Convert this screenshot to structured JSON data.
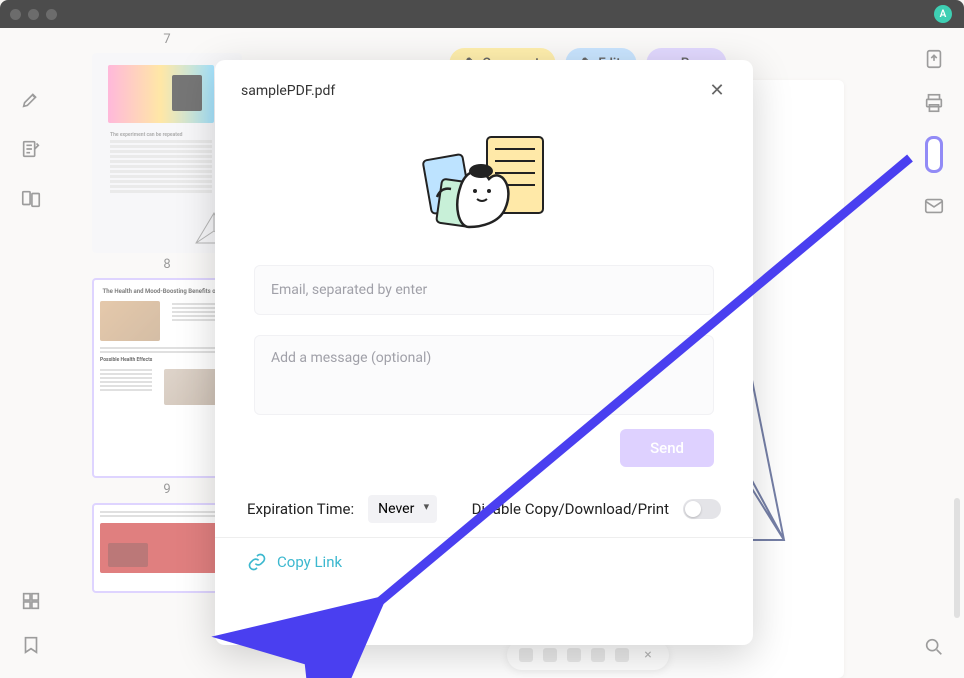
{
  "window": {
    "avatar_initial": "A"
  },
  "thumbs": {
    "page7": "7",
    "page8": "8",
    "page9": "9",
    "t2_title": "The Health and Mood-Boosting Benefits of Pets",
    "t2_sub": "Possible Health Effects"
  },
  "toolbar": {
    "comment": "Comment",
    "edit": "Edit",
    "page": "Page"
  },
  "modal": {
    "title": "samplePDF.pdf",
    "email_placeholder": "Email, separated by enter",
    "message_placeholder": "Add a message (optional)",
    "send_label": "Send",
    "expiration_label": "Expiration Time:",
    "expiration_value": "Never",
    "disable_label": "Disable Copy/Download/Print",
    "copy_link": "Copy Link"
  }
}
